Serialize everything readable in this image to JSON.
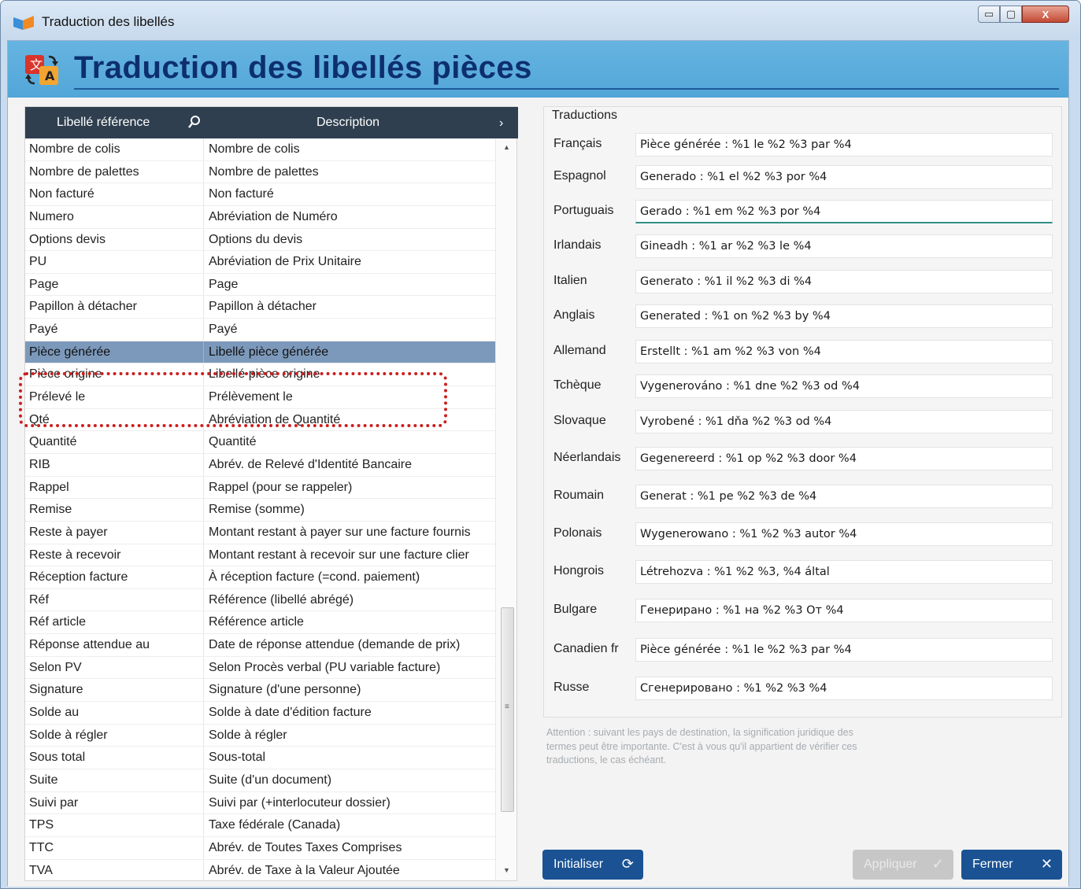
{
  "window": {
    "title": "Traduction des libellés",
    "buttons": {
      "minimize": "▭",
      "maximize": "▢",
      "close": "X"
    }
  },
  "header": {
    "title": "Traduction des libellés pièces"
  },
  "table": {
    "columns": [
      "Libellé référence",
      "Description"
    ],
    "rows": [
      [
        "Nombre de colis",
        "Nombre de colis"
      ],
      [
        "Nombre de palettes",
        "Nombre de palettes"
      ],
      [
        "Non facturé",
        "Non facturé"
      ],
      [
        "Numero",
        "Abréviation de Numéro"
      ],
      [
        "Options devis",
        "Options du devis"
      ],
      [
        "PU",
        "Abréviation de Prix Unitaire"
      ],
      [
        "Page",
        "Page"
      ],
      [
        "Papillon à détacher",
        "Papillon à détacher"
      ],
      [
        "Payé",
        "Payé"
      ],
      [
        "Pièce générée",
        "Libellé pièce générée"
      ],
      [
        "Pièce origine",
        "Libellé pièce origine"
      ],
      [
        "Prélevé le",
        "Prélèvement le"
      ],
      [
        "Qté",
        "Abréviation de Quantité"
      ],
      [
        "Quantité",
        "Quantité"
      ],
      [
        "RIB",
        "Abrév. de Relevé d'Identité Bancaire"
      ],
      [
        "Rappel",
        "Rappel (pour se rappeler)"
      ],
      [
        "Remise",
        "Remise (somme)"
      ],
      [
        "Reste à payer",
        "Montant restant à payer sur une facture fournis"
      ],
      [
        "Reste à recevoir",
        "Montant restant à recevoir sur une facture clier"
      ],
      [
        "Réception facture",
        "À réception facture (=cond. paiement)"
      ],
      [
        "Réf",
        "Référence (libellé abrégé)"
      ],
      [
        "Réf article",
        "Référence article"
      ],
      [
        "Réponse attendue au",
        "Date de réponse attendue (demande de prix)"
      ],
      [
        "Selon PV",
        "Selon Procès verbal (PU variable facture)"
      ],
      [
        "Signature",
        "Signature (d'une personne)"
      ],
      [
        "Solde au",
        "Solde à date d'édition facture"
      ],
      [
        "Solde à régler",
        "Solde à régler"
      ],
      [
        "Sous total",
        "Sous-total"
      ],
      [
        "Suite",
        "Suite (d'un document)"
      ],
      [
        "Suivi par",
        "Suivi par (+interlocuteur dossier)"
      ],
      [
        "TPS",
        "Taxe fédérale (Canada)"
      ],
      [
        "TTC",
        "Abrév. de Toutes Taxes Comprises"
      ],
      [
        "TVA",
        "Abrév. de Taxe à la Valeur Ajoutée"
      ]
    ],
    "selected_index": 9
  },
  "translations": {
    "title": "Traductions",
    "items": [
      {
        "lang": "Français",
        "value": "Pièce générée : %1 le %2 %3 par %4"
      },
      {
        "lang": "Espagnol",
        "value": "Generado : %1 el %2 %3 por %4"
      },
      {
        "lang": "Portuguais",
        "value": "Gerado : %1 em %2 %3 por %4"
      },
      {
        "lang": "Irlandais",
        "value": "Gineadh :  %1 ar %2 %3 le %4"
      },
      {
        "lang": "Italien",
        "value": "Generato : %1 il %2 %3 di %4"
      },
      {
        "lang": "Anglais",
        "value": "Generated : %1 on %2 %3 by %4"
      },
      {
        "lang": "Allemand",
        "value": "Erstellt : %1 am %2 %3 von %4"
      },
      {
        "lang": "Tchèque",
        "value": "Vygenerováno : %1 dne %2 %3 od %4"
      },
      {
        "lang": "Slovaque",
        "value": "Vyrobené : %1 dňa %2 %3 od %4"
      },
      {
        "lang": "Néerlandais",
        "value": "Gegenereerd : %1 op %2 %3 door %4"
      },
      {
        "lang": "Roumain",
        "value": "Generat : %1 pe %2 %3 de %4"
      },
      {
        "lang": "Polonais",
        "value": "Wygenerowano : %1 %2 %3 autor %4"
      },
      {
        "lang": "Hongrois",
        "value": "Létrehozva : %1 %2 %3, %4 által"
      },
      {
        "lang": "Bulgare",
        "value": "Генерирано : %1 на %2 %3 От %4"
      },
      {
        "lang": "Canadien fr",
        "value": "Pièce générée : %1 le %2 %3 par %4"
      },
      {
        "lang": "Russe",
        "value": "Сгенерировано : %1 %2 %3 %4"
      }
    ]
  },
  "note": "Attention : suivant les pays de destination, la signification juridique des termes peut être importante. C'est à vous qu'il appartient de vérifier ces traductions, le cas échéant.",
  "buttons": {
    "init": "Initialiser",
    "apply": "Appliquer",
    "close": "Fermer"
  },
  "colors": {
    "header_band": "#5aaedd",
    "header_title": "#0d2f6e",
    "table_header": "#2f3f4f",
    "selected_row": "#7c99bb",
    "primary_button": "#1a5294",
    "disabled_button": "#c7c7c7",
    "highlight": "#cc1f1f"
  }
}
